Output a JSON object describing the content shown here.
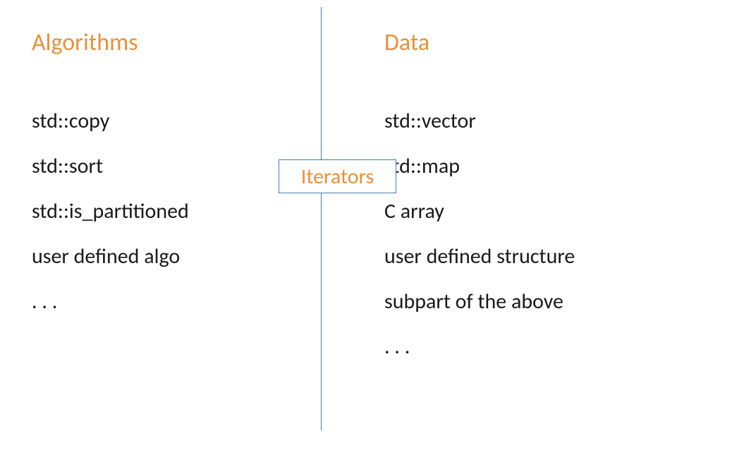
{
  "left": {
    "heading": "Algorithms",
    "items": [
      "std::copy",
      "std::sort",
      "std::is_partitioned",
      "user defined algo",
      ". . ."
    ]
  },
  "right": {
    "heading": "Data",
    "items": [
      "std::vector",
      "std::map",
      "C array",
      "user defined structure",
      "subpart of the above",
      ". . ."
    ]
  },
  "center": {
    "label": "Iterators"
  }
}
